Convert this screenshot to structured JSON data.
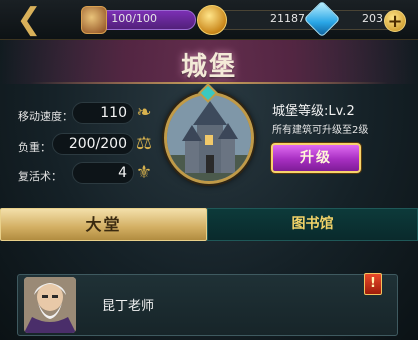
{
  "topbar": {
    "back_icon": "back-arrow-icon",
    "stamina": "100/100",
    "gold": "21187",
    "gems": "203",
    "add_label": "+"
  },
  "page": {
    "title": "城堡"
  },
  "stats": [
    {
      "label": "移动速度：",
      "value": "110",
      "icon": "boot-icon"
    },
    {
      "label": "负重：",
      "value": "200/200",
      "icon": "weight-icon"
    },
    {
      "label": "复活术：",
      "value": "4",
      "icon": "revive-icon"
    }
  ],
  "castle": {
    "level_text": "城堡等级:Lv.2",
    "upgrade_hint": "所有建筑可升级至2级",
    "upgrade_button": "升级"
  },
  "tabs": [
    {
      "label": "大堂",
      "active": true
    },
    {
      "label": "图书馆",
      "active": false
    }
  ],
  "list": [
    {
      "name": "昆丁老师",
      "alert": "!"
    }
  ],
  "colors": {
    "accent_gold": "#d8b24e",
    "upgrade_purple": "#a72fc1",
    "tab_active": "#d2ae62"
  }
}
